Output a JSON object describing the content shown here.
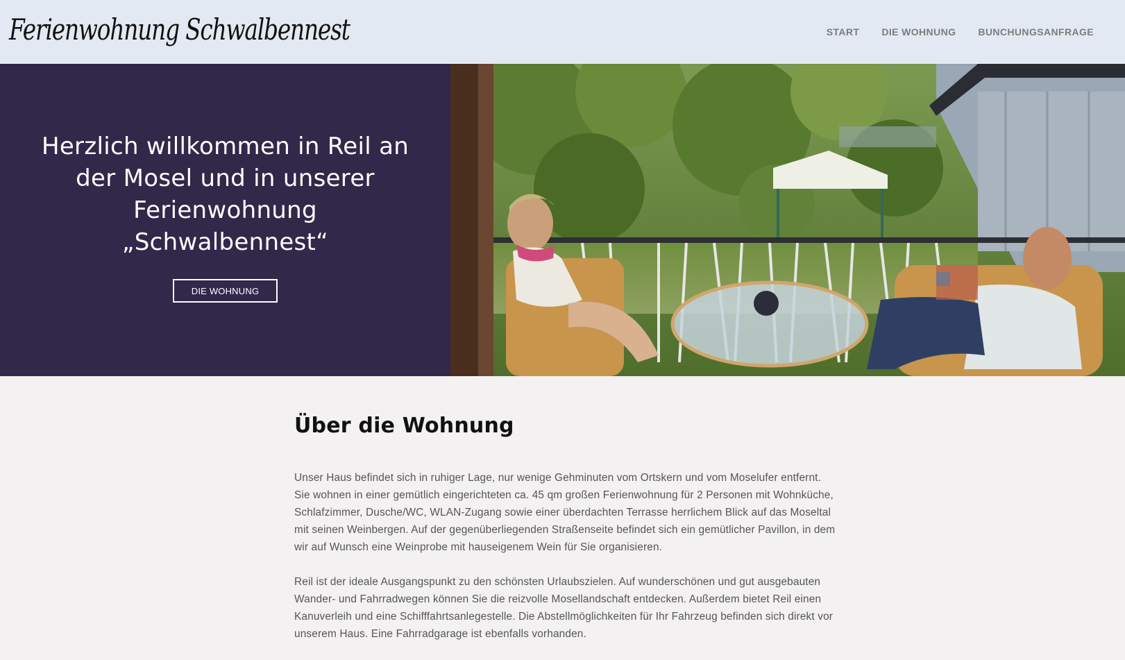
{
  "header": {
    "logo_text": "Ferienwohnung Schwalbennest",
    "nav": [
      {
        "label": "START"
      },
      {
        "label": "DIE WOHNUNG"
      },
      {
        "label": "BUNCHUNGSANFRAGE"
      }
    ]
  },
  "hero": {
    "title": "Herzlich willkommen in Reil an der Mosel und in unserer Ferienwohnung „Schwalbennest“",
    "button_label": "DIE WOHNUNG",
    "panel_color": "#31284a",
    "photo_icon": "balcony-photo"
  },
  "about": {
    "title": "Über die Wohnung",
    "paragraphs": [
      "Unser Haus befindet sich in ruhiger Lage, nur wenige Gehminuten vom Ortskern und vom Moselufer entfernt. Sie wohnen in einer gemütlich eingerichteten ca. 45 qm großen Ferienwohnung für 2 Personen mit Wohnküche, Schlafzimmer, Dusche/WC, WLAN-Zugang sowie einer überdachten Terrasse herrlichem Blick auf das Moseltal mit seinen Weinbergen. Auf der gegenüberliegenden Straßenseite befindet sich ein gemütlicher Pavillon, in dem wir auf Wunsch eine Weinprobe mit hauseigenem Wein für Sie organisieren.",
      "Reil ist der ideale Ausgangspunkt zu den schönsten Urlaubszielen. Auf wunderschönen und gut ausgebauten Wander- und Fahrradwegen können Sie die reizvolle Mosellandschaft entdecken. Außerdem bietet Reil einen Kanuverleih und eine Schifffahrtsanlegestelle. Die Abstellmöglichkeiten für Ihr Fahrzeug befinden sich direkt vor unserem Haus. Eine Fahrradgarage ist ebenfalls vorhanden."
    ]
  },
  "colors": {
    "header_bg": "#e3e9f3",
    "page_bg": "#f3f1f2",
    "nav_text": "#7c7c7c"
  }
}
